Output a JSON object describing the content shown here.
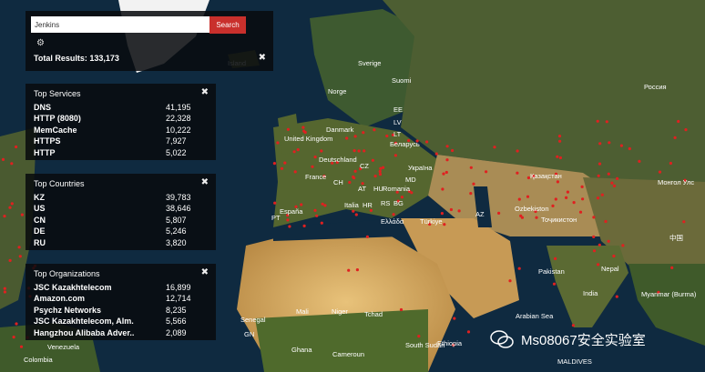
{
  "search": {
    "value": "Jenkins",
    "button_label": "Search"
  },
  "total_results": "Total Results: 133,173",
  "top_services": {
    "title": "Top Services",
    "rows": [
      {
        "name": "DNS",
        "count": "41,195"
      },
      {
        "name": "HTTP (8080)",
        "count": "22,328"
      },
      {
        "name": "MemCache",
        "count": "10,222"
      },
      {
        "name": "HTTPS",
        "count": "7,927"
      },
      {
        "name": "HTTP",
        "count": "5,022"
      }
    ]
  },
  "top_countries": {
    "title": "Top Countries",
    "rows": [
      {
        "name": "KZ",
        "count": "39,783"
      },
      {
        "name": "US",
        "count": "38,646"
      },
      {
        "name": "CN",
        "count": "5,807"
      },
      {
        "name": "DE",
        "count": "5,246"
      },
      {
        "name": "RU",
        "count": "3,820"
      }
    ]
  },
  "top_orgs": {
    "title": "Top Organizations",
    "rows": [
      {
        "name": "JSC Kazakhtelecom",
        "count": "16,899"
      },
      {
        "name": "Amazon.com",
        "count": "12,714"
      },
      {
        "name": "Psychz Networks",
        "count": "8,235"
      },
      {
        "name": "JSC Kazakhtelecom, Alm...",
        "count": "5,566"
      },
      {
        "name": "Hangzhou Alibaba Adver...",
        "count": "2,089"
      }
    ]
  },
  "map_labels": [
    "Island",
    "Sverige",
    "Suomi",
    "Россия",
    "Norge",
    "EE",
    "LV",
    "LT",
    "Danmark",
    "United Kingdom",
    "Беларусь",
    "Deutschland",
    "CZ",
    "Україна",
    "France",
    "CH",
    "AT",
    "HU",
    "Romania",
    "MD",
    "Қазақстан",
    "Монгол Улс",
    "Italia",
    "HR",
    "RS",
    "BG",
    "Ελλάδα",
    "España",
    "PT",
    "Türkiye",
    "AZ",
    "Ozbekiston",
    "Тоҷикистон",
    "中国",
    "Senegal",
    "Mali",
    "Niger",
    "Tchad",
    "Nepal",
    "Pakistan",
    "India",
    "Myanmar (Burma)",
    "GN",
    "Ghana",
    "Cameroun",
    "South Sudan",
    "Ethiopia",
    "Venezuela",
    "Colombia",
    "Arabian Sea",
    "MALDIVES"
  ],
  "watermark": "Ms08067安全实验室",
  "colors": {
    "accent": "#c9302c",
    "marker": "#e02020"
  }
}
